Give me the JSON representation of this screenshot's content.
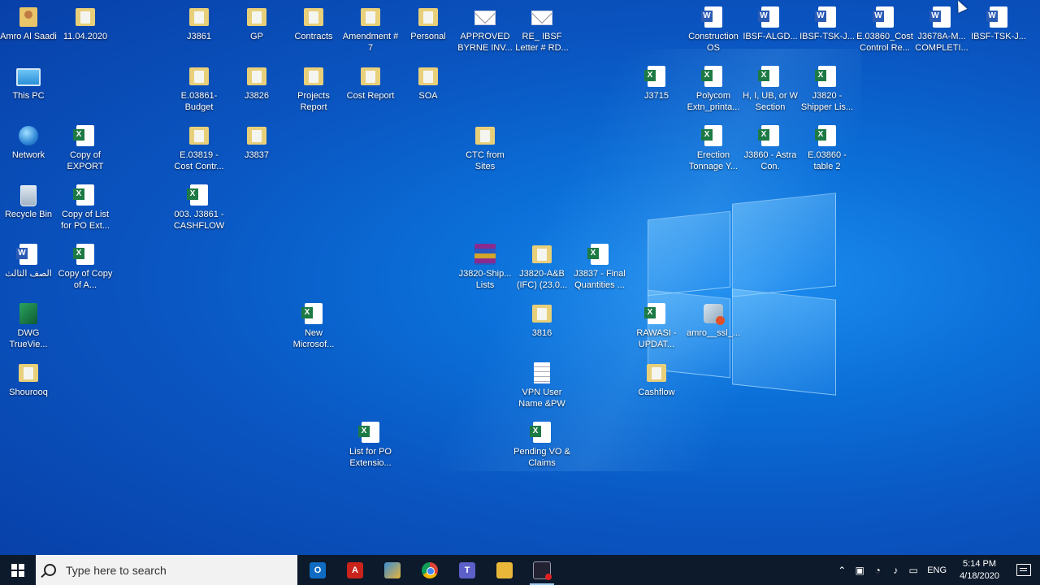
{
  "desktop": {
    "icons": [
      {
        "label": "Amro Al Saadi",
        "type": "avatar"
      },
      {
        "label": "11.04.2020",
        "type": "folder"
      },
      {
        "label": "J3861",
        "type": "folder"
      },
      {
        "label": "GP",
        "type": "folder"
      },
      {
        "label": "Contracts",
        "type": "folder"
      },
      {
        "label": "Amendment # 7",
        "type": "folder"
      },
      {
        "label": "Personal",
        "type": "folder"
      },
      {
        "label": "APPROVED BYRNE INV...",
        "type": "mail"
      },
      {
        "label": "RE_ IBSF Letter # RD...",
        "type": "mail"
      },
      {
        "label": "Construction OS",
        "type": "word"
      },
      {
        "label": "IBSF-ALGD...",
        "type": "word"
      },
      {
        "label": "IBSF-TSK-J...",
        "type": "word"
      },
      {
        "label": "E.03860_Cost Control Re...",
        "type": "word"
      },
      {
        "label": "J3678A-M... COMPLETI...",
        "type": "word"
      },
      {
        "label": "IBSF-TSK-J...",
        "type": "word"
      },
      {
        "label": "This PC",
        "type": "pc"
      },
      {
        "label": "E.03861-Budget",
        "type": "folder"
      },
      {
        "label": "J3826",
        "type": "folder"
      },
      {
        "label": "Projects Report",
        "type": "folder"
      },
      {
        "label": "Cost Report",
        "type": "folder"
      },
      {
        "label": "SOA",
        "type": "folder"
      },
      {
        "label": "J3715",
        "type": "excel"
      },
      {
        "label": "Polycom Extn_printa...",
        "type": "excel"
      },
      {
        "label": "H, I, UB, or W Section",
        "type": "excel"
      },
      {
        "label": "J3820 - Shipper Lis...",
        "type": "excel"
      },
      {
        "label": "Network",
        "type": "network"
      },
      {
        "label": "Copy of EXPORT",
        "type": "excel"
      },
      {
        "label": "E.03819 - Cost Contr...",
        "type": "folder"
      },
      {
        "label": "J3837",
        "type": "folder"
      },
      {
        "label": "CTC from Sites",
        "type": "folder"
      },
      {
        "label": "Erection Tonnage Y...",
        "type": "excel"
      },
      {
        "label": "J3860 - Astra Con.",
        "type": "excel"
      },
      {
        "label": "E.03860 - table 2",
        "type": "excel"
      },
      {
        "label": "Recycle Bin",
        "type": "bin"
      },
      {
        "label": "Copy of List for PO Ext...",
        "type": "excel"
      },
      {
        "label": "003. J3861 - CASHFLOW",
        "type": "excel"
      },
      {
        "label": "الصف الثالث",
        "type": "word"
      },
      {
        "label": "Copy of Copy of A...",
        "type": "excel"
      },
      {
        "label": "J3820-Ship... Lists",
        "type": "rar"
      },
      {
        "label": "J3820-A&B (IFC) (23.0...",
        "type": "folder"
      },
      {
        "label": "J3837 - Final Quantities ...",
        "type": "excel"
      },
      {
        "label": "DWG TrueVie...",
        "type": "dwg"
      },
      {
        "label": "New Microsof...",
        "type": "excel"
      },
      {
        "label": "3816",
        "type": "folder"
      },
      {
        "label": "RAWASI - UPDAT...",
        "type": "excel"
      },
      {
        "label": "amro__ssl_...",
        "type": "ssl"
      },
      {
        "label": "Shourooq",
        "type": "folder"
      },
      {
        "label": "VPN User Name &PW",
        "type": "txt"
      },
      {
        "label": "Cashflow",
        "type": "folder"
      },
      {
        "label": "List for PO Extensio...",
        "type": "excel"
      },
      {
        "label": "Pending VO & Claims",
        "type": "excel"
      }
    ]
  },
  "taskbar": {
    "search_placeholder": "Type here to search",
    "apps": [
      {
        "name": "Outlook",
        "icon": "outlook-icon",
        "glyph": "O"
      },
      {
        "name": "Adobe Acrobat",
        "icon": "acrobat-icon",
        "glyph": "A"
      },
      {
        "name": "Files",
        "icon": "files-icon",
        "glyph": ""
      },
      {
        "name": "Google Chrome",
        "icon": "chrome-icon",
        "glyph": ""
      },
      {
        "name": "Microsoft Teams",
        "icon": "teams-icon",
        "glyph": "T"
      },
      {
        "name": "File Explorer",
        "icon": "explorer-icon",
        "glyph": ""
      },
      {
        "name": "Screen Recorder",
        "icon": "recorder-icon",
        "glyph": ""
      }
    ],
    "tray": {
      "language": "ENG",
      "time": "5:14 PM",
      "date": "4/18/2020"
    }
  }
}
